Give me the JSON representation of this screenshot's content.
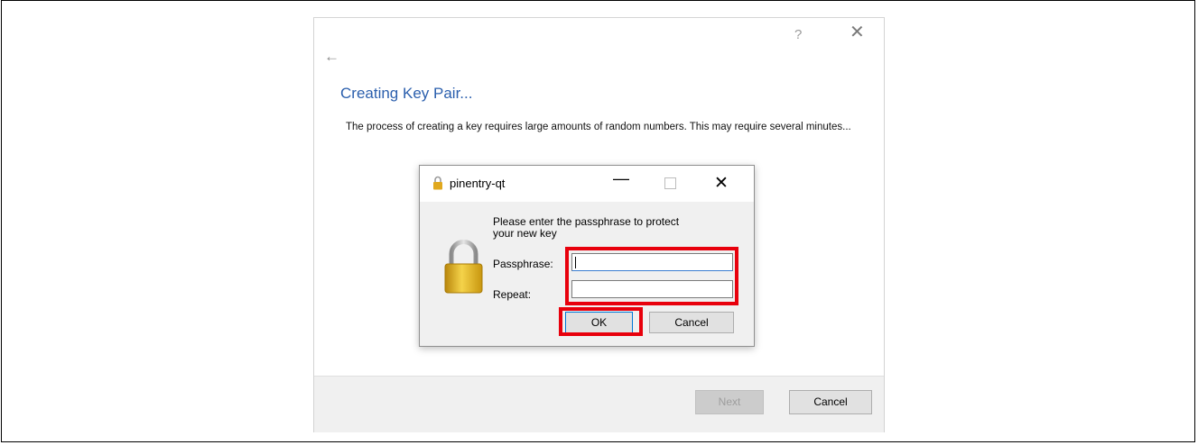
{
  "wizard": {
    "help_glyph": "?",
    "close_glyph": "✕",
    "back_glyph": "←",
    "title": "Creating Key Pair...",
    "description": "The process of creating a key requires large amounts of random numbers. This may require several minutes...",
    "next_label": "Next",
    "cancel_label": "Cancel"
  },
  "dialog": {
    "title": "pinentry-qt",
    "minimize_glyph": "—",
    "close_glyph": "✕",
    "message": "Please enter the passphrase to protect your new key",
    "passphrase_label": "Passphrase:",
    "repeat_label": "Repeat:",
    "passphrase_value": "",
    "repeat_value": "",
    "ok_label": "OK",
    "cancel_label": "Cancel"
  },
  "colors": {
    "accent": "#2b5fad",
    "highlight": "#e8000c",
    "lock_gold": "#d9a521"
  },
  "icons": {
    "lock": "padlock-icon"
  }
}
